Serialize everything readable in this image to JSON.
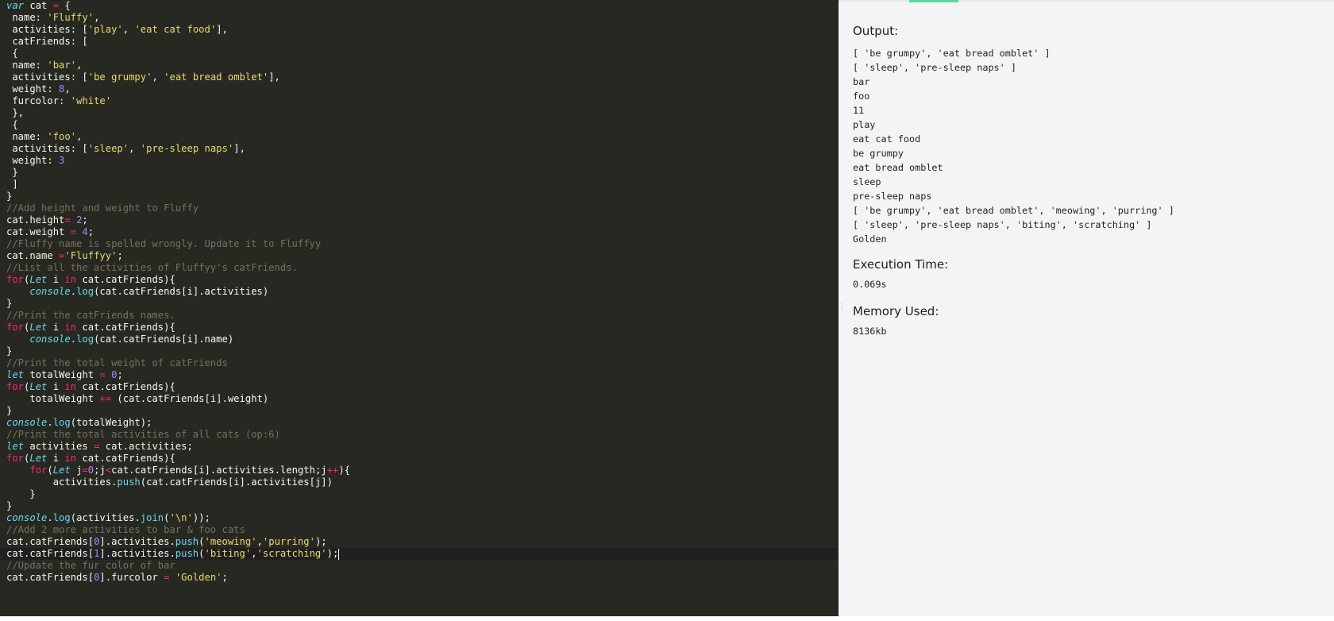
{
  "editor": {
    "lines": [
      [
        [
          "k",
          "var"
        ],
        [
          "p",
          " cat "
        ],
        [
          "o",
          "="
        ],
        [
          "p",
          " {"
        ]
      ],
      [
        [
          "p",
          " name: "
        ],
        [
          "s",
          "'Fluffy'"
        ],
        [
          "p",
          ","
        ]
      ],
      [
        [
          "p",
          " activities: ["
        ],
        [
          "s",
          "'play'"
        ],
        [
          "p",
          ", "
        ],
        [
          "s",
          "'eat cat food'"
        ],
        [
          "p",
          "],"
        ]
      ],
      [
        [
          "p",
          " catFriends: ["
        ]
      ],
      [
        [
          "p",
          " {"
        ]
      ],
      [
        [
          "p",
          " name: "
        ],
        [
          "s",
          "'bar'"
        ],
        [
          "p",
          ","
        ]
      ],
      [
        [
          "p",
          " activities: ["
        ],
        [
          "s",
          "'be grumpy'"
        ],
        [
          "p",
          ", "
        ],
        [
          "s",
          "'eat bread omblet'"
        ],
        [
          "p",
          "],"
        ]
      ],
      [
        [
          "p",
          " weight: "
        ],
        [
          "n",
          "8"
        ],
        [
          "p",
          ","
        ]
      ],
      [
        [
          "p",
          " furcolor: "
        ],
        [
          "s",
          "'white'"
        ]
      ],
      [
        [
          "p",
          " },"
        ]
      ],
      [
        [
          "p",
          " {"
        ]
      ],
      [
        [
          "p",
          " name: "
        ],
        [
          "s",
          "'foo'"
        ],
        [
          "p",
          ","
        ]
      ],
      [
        [
          "p",
          " activities: ["
        ],
        [
          "s",
          "'sleep'"
        ],
        [
          "p",
          ", "
        ],
        [
          "s",
          "'pre-sleep naps'"
        ],
        [
          "p",
          "],"
        ]
      ],
      [
        [
          "p",
          " weight: "
        ],
        [
          "n",
          "3"
        ]
      ],
      [
        [
          "p",
          " }"
        ]
      ],
      [
        [
          "p",
          " ]"
        ]
      ],
      [
        [
          "p",
          "}"
        ]
      ],
      [
        [
          "c",
          "//Add height and weight to Fluffy"
        ]
      ],
      [
        [
          "p",
          "cat.height"
        ],
        [
          "o",
          "="
        ],
        [
          "p",
          " "
        ],
        [
          "n",
          "2"
        ],
        [
          "p",
          ";"
        ]
      ],
      [
        [
          "p",
          "cat.weight "
        ],
        [
          "o",
          "="
        ],
        [
          "p",
          " "
        ],
        [
          "n",
          "4"
        ],
        [
          "p",
          ";"
        ]
      ],
      [
        [
          "c",
          "//Fluffy name is spelled wrongly. Update it to Fluffyy"
        ]
      ],
      [
        [
          "p",
          "cat.name "
        ],
        [
          "o",
          "="
        ],
        [
          "s",
          "'Fluffyy'"
        ],
        [
          "p",
          ";"
        ]
      ],
      [
        [
          "c",
          "//List all the activities of Fluffyy's catFriends."
        ]
      ],
      [
        [
          "kw",
          "for"
        ],
        [
          "p",
          "("
        ],
        [
          "k",
          "Let"
        ],
        [
          "p",
          " i "
        ],
        [
          "kw",
          "in"
        ],
        [
          "p",
          " cat.catFriends){"
        ]
      ],
      [
        [
          "p",
          "    "
        ],
        [
          "fi",
          "console"
        ],
        [
          "p",
          "."
        ],
        [
          "f",
          "log"
        ],
        [
          "p",
          "(cat.catFriends[i].activities)"
        ]
      ],
      [
        [
          "p",
          "}"
        ]
      ],
      [
        [
          "c",
          "//Print the catFriends names."
        ]
      ],
      [
        [
          "kw",
          "for"
        ],
        [
          "p",
          "("
        ],
        [
          "k",
          "Let"
        ],
        [
          "p",
          " i "
        ],
        [
          "kw",
          "in"
        ],
        [
          "p",
          " cat.catFriends){"
        ]
      ],
      [
        [
          "p",
          "    "
        ],
        [
          "fi",
          "console"
        ],
        [
          "p",
          "."
        ],
        [
          "f",
          "log"
        ],
        [
          "p",
          "(cat.catFriends[i].name)"
        ]
      ],
      [
        [
          "p",
          "}"
        ]
      ],
      [
        [
          "c",
          "//Print the total weight of catFriends"
        ]
      ],
      [
        [
          "k",
          "let"
        ],
        [
          "p",
          " totalWeight "
        ],
        [
          "o",
          "="
        ],
        [
          "p",
          " "
        ],
        [
          "n",
          "0"
        ],
        [
          "p",
          ";"
        ]
      ],
      [
        [
          "kw",
          "for"
        ],
        [
          "p",
          "("
        ],
        [
          "k",
          "Let"
        ],
        [
          "p",
          " i "
        ],
        [
          "kw",
          "in"
        ],
        [
          "p",
          " cat.catFriends){"
        ]
      ],
      [
        [
          "p",
          "    totalWeight "
        ],
        [
          "o",
          "+="
        ],
        [
          "p",
          " (cat.catFriends[i].weight)"
        ]
      ],
      [
        [
          "p",
          "}"
        ]
      ],
      [
        [
          "fi",
          "console"
        ],
        [
          "p",
          "."
        ],
        [
          "f",
          "log"
        ],
        [
          "p",
          "(totalWeight);"
        ]
      ],
      [
        [
          "c",
          "//Print the total activities of all cats (op:6)"
        ]
      ],
      [
        [
          "k",
          "let"
        ],
        [
          "p",
          " activities "
        ],
        [
          "o",
          "="
        ],
        [
          "p",
          " cat.activities;"
        ]
      ],
      [
        [
          "kw",
          "for"
        ],
        [
          "p",
          "("
        ],
        [
          "k",
          "Let"
        ],
        [
          "p",
          " i "
        ],
        [
          "kw",
          "in"
        ],
        [
          "p",
          " cat.catFriends){"
        ]
      ],
      [
        [
          "p",
          "    "
        ],
        [
          "kw",
          "for"
        ],
        [
          "p",
          "("
        ],
        [
          "k",
          "Let"
        ],
        [
          "p",
          " j"
        ],
        [
          "o",
          "="
        ],
        [
          "n",
          "0"
        ],
        [
          "p",
          ";j"
        ],
        [
          "o",
          "<"
        ],
        [
          "p",
          "cat.catFriends[i].activities.length;j"
        ],
        [
          "o",
          "++"
        ],
        [
          "p",
          "){"
        ]
      ],
      [
        [
          "p",
          "        activities."
        ],
        [
          "f",
          "push"
        ],
        [
          "p",
          "(cat.catFriends[i].activities[j])"
        ]
      ],
      [
        [
          "p",
          "    }"
        ]
      ],
      [
        [
          "p",
          "}"
        ]
      ],
      [
        [
          "fi",
          "console"
        ],
        [
          "p",
          "."
        ],
        [
          "f",
          "log"
        ],
        [
          "p",
          "(activities."
        ],
        [
          "f",
          "join"
        ],
        [
          "p",
          "("
        ],
        [
          "s",
          "'\\n'"
        ],
        [
          "p",
          "));"
        ]
      ],
      [
        [
          "c",
          "//Add 2 more activities to bar & foo cats"
        ]
      ],
      [
        [
          "p",
          "cat.catFriends["
        ],
        [
          "n",
          "0"
        ],
        [
          "p",
          "].activities."
        ],
        [
          "f",
          "push"
        ],
        [
          "p",
          "("
        ],
        [
          "s",
          "'meowing'"
        ],
        [
          "p",
          ","
        ],
        [
          "s",
          "'purring'"
        ],
        [
          "p",
          ");"
        ]
      ],
      [
        [
          "p",
          "cat.catFriends["
        ],
        [
          "n",
          "1"
        ],
        [
          "p",
          "].activities."
        ],
        [
          "f",
          "push"
        ],
        [
          "p",
          "("
        ],
        [
          "s",
          "'biting'"
        ],
        [
          "p",
          ","
        ],
        [
          "s",
          "'scratching'"
        ],
        [
          "p",
          ");"
        ]
      ],
      [
        [
          "c",
          "//Update the fur color of bar"
        ]
      ],
      [
        [
          "p",
          "cat.catFriends["
        ],
        [
          "n",
          "0"
        ],
        [
          "p",
          "].furcolor "
        ],
        [
          "o",
          "="
        ],
        [
          "p",
          " "
        ],
        [
          "s",
          "'Golden'"
        ],
        [
          "p",
          ";"
        ]
      ]
    ],
    "active_line": 46
  },
  "output": {
    "output_title": "Output:",
    "output_lines": [
      "[ 'be grumpy', 'eat bread omblet' ]",
      "[ 'sleep', 'pre-sleep naps' ]",
      "bar",
      "foo",
      "11",
      "play",
      "eat cat food",
      "be grumpy",
      "eat bread omblet",
      "sleep",
      "pre-sleep naps",
      "[ 'be grumpy', 'eat bread omblet', 'meowing', 'purring' ]",
      "[ 'sleep', 'pre-sleep naps', 'biting', 'scratching' ]",
      "Golden"
    ],
    "exec_title": "Execution Time:",
    "exec_value": "0.069s",
    "mem_title": "Memory Used:",
    "mem_value": "8136kb"
  },
  "colors": {
    "editor_bg": "#272822",
    "output_bg": "#f4f4f6",
    "accent_tab": "#5fd4a0"
  }
}
